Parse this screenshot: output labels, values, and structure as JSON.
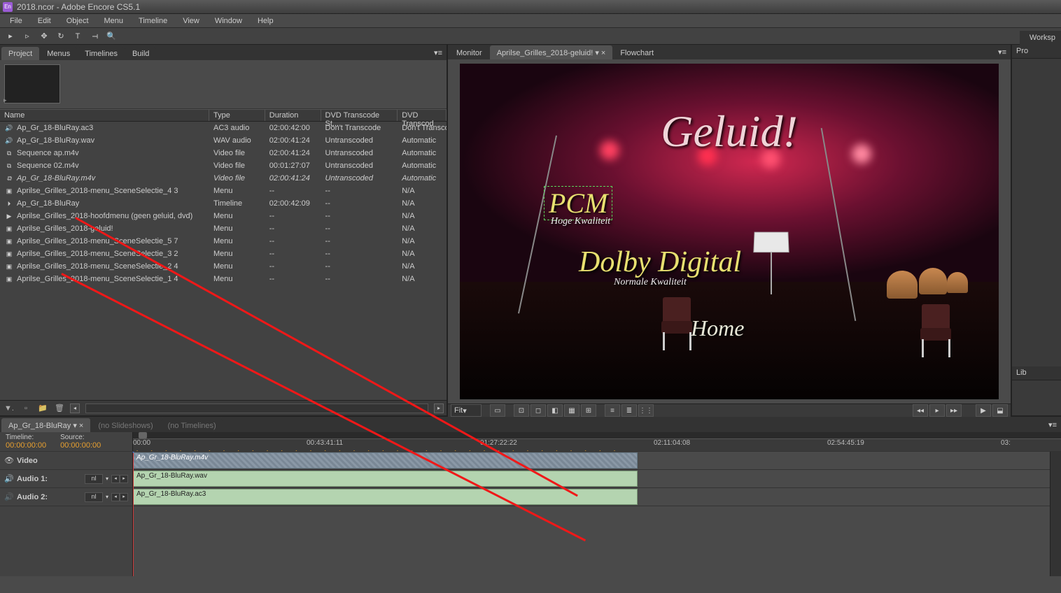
{
  "window": {
    "title": "2018.ncor - Adobe Encore CS5.1",
    "app_abbr": "En"
  },
  "menu": [
    "File",
    "Edit",
    "Object",
    "Menu",
    "Timeline",
    "View",
    "Window",
    "Help"
  ],
  "workspace": "Worksp",
  "left_tabs": [
    "Project",
    "Menus",
    "Timelines",
    "Build"
  ],
  "right_strip": [
    "Pro",
    "Lib"
  ],
  "project": {
    "headers": [
      "Name",
      "Type",
      "Duration",
      "DVD Transcode St...",
      "DVD Transcod"
    ],
    "rows": [
      {
        "icon": "🔊",
        "name": "Ap_Gr_18-BluRay.ac3",
        "type": "AC3 audio",
        "dur": "02:00:42:00",
        "d1": "Don't Transcode",
        "d2": "Don't Transco"
      },
      {
        "icon": "🔊",
        "name": "Ap_Gr_18-BluRay.wav",
        "type": "WAV audio",
        "dur": "02:00:41:24",
        "d1": "Untranscoded",
        "d2": "Automatic"
      },
      {
        "icon": "⧉",
        "name": "Sequence ap.m4v",
        "type": "Video file",
        "dur": "02:00:41:24",
        "d1": "Untranscoded",
        "d2": "Automatic"
      },
      {
        "icon": "⧉",
        "name": "Sequence 02.m4v",
        "type": "Video file",
        "dur": "00:01:27:07",
        "d1": "Untranscoded",
        "d2": "Automatic"
      },
      {
        "icon": "⧉",
        "name": "Ap_Gr_18-BluRay.m4v",
        "type": "Video file",
        "dur": "02:00:41:24",
        "d1": "Untranscoded",
        "d2": "Automatic",
        "italic": true
      },
      {
        "icon": "▣",
        "name": "Aprilse_Grilles_2018-menu_SceneSelectie_4 3",
        "type": "Menu",
        "dur": "--",
        "d1": "--",
        "d2": "N/A"
      },
      {
        "icon": "⏵",
        "name": "Ap_Gr_18-BluRay",
        "type": "Timeline",
        "dur": "02:00:42:09",
        "d1": "--",
        "d2": "N/A"
      },
      {
        "icon": "▶",
        "name": "Aprilse_Grilles_2018-hoofdmenu (geen geluid, dvd)",
        "type": "Menu",
        "dur": "--",
        "d1": "--",
        "d2": "N/A"
      },
      {
        "icon": "▣",
        "name": "Aprilse_Grilles_2018-geluid!",
        "type": "Menu",
        "dur": "--",
        "d1": "--",
        "d2": "N/A"
      },
      {
        "icon": "▣",
        "name": "Aprilse_Grilles_2018-menu_SceneSelectie_5 7",
        "type": "Menu",
        "dur": "--",
        "d1": "--",
        "d2": "N/A"
      },
      {
        "icon": "▣",
        "name": "Aprilse_Grilles_2018-menu_SceneSelectie_3 2",
        "type": "Menu",
        "dur": "--",
        "d1": "--",
        "d2": "N/A"
      },
      {
        "icon": "▣",
        "name": "Aprilse_Grilles_2018-menu_SceneSelectie_2 4",
        "type": "Menu",
        "dur": "--",
        "d1": "--",
        "d2": "N/A"
      },
      {
        "icon": "▣",
        "name": "Aprilse_Grilles_2018-menu_SceneSelectie_1 4",
        "type": "Menu",
        "dur": "--",
        "d1": "--",
        "d2": "N/A"
      }
    ]
  },
  "monitor": {
    "tabs": [
      "Monitor",
      "Aprilse_Grilles_2018-geluid!",
      "Flowchart"
    ],
    "fit": "Fit",
    "menu_title": "Geluid!",
    "pcm": "PCM",
    "pcm_sub": "Hoge Kwaliteit",
    "dolby": "Dolby Digital",
    "dolby_sub": "Normale Kwaliteit",
    "home": "Home"
  },
  "timeline": {
    "tab_active": "Ap_Gr_18-BluRay",
    "tab_ghost1": "(no Slideshows)",
    "tab_ghost2": "(no Timelines)",
    "tl_label": "Timeline:",
    "src_label": "Source:",
    "tl_tc": "00:00:00:00",
    "src_tc": "00:00:00:00",
    "ruler": [
      "00:00",
      "00:43:41:11",
      "01:27:22:22",
      "02:11:04:08",
      "02:54:45:19",
      "03:"
    ],
    "chapters": [
      "1",
      "2",
      "3",
      "4",
      "5",
      "6",
      "7",
      "8",
      "9",
      "10",
      "11",
      "12",
      "13",
      "14",
      "15",
      "16",
      "17",
      "18",
      "19",
      "20",
      "21",
      "22",
      "23",
      "24",
      "25",
      "26",
      "27",
      "28",
      "29",
      "30",
      "31",
      "32",
      "33",
      "34"
    ],
    "tracks": {
      "video": {
        "label": "Video",
        "clip": "Ap_Gr_18-BluRay.m4v"
      },
      "audio1": {
        "label": "Audio 1:",
        "lang": "nl",
        "clip": "Ap_Gr_18-BluRay.wav"
      },
      "audio2": {
        "label": "Audio 2:",
        "lang": "nl",
        "clip": "Ap_Gr_18-BluRay.ac3"
      }
    }
  }
}
